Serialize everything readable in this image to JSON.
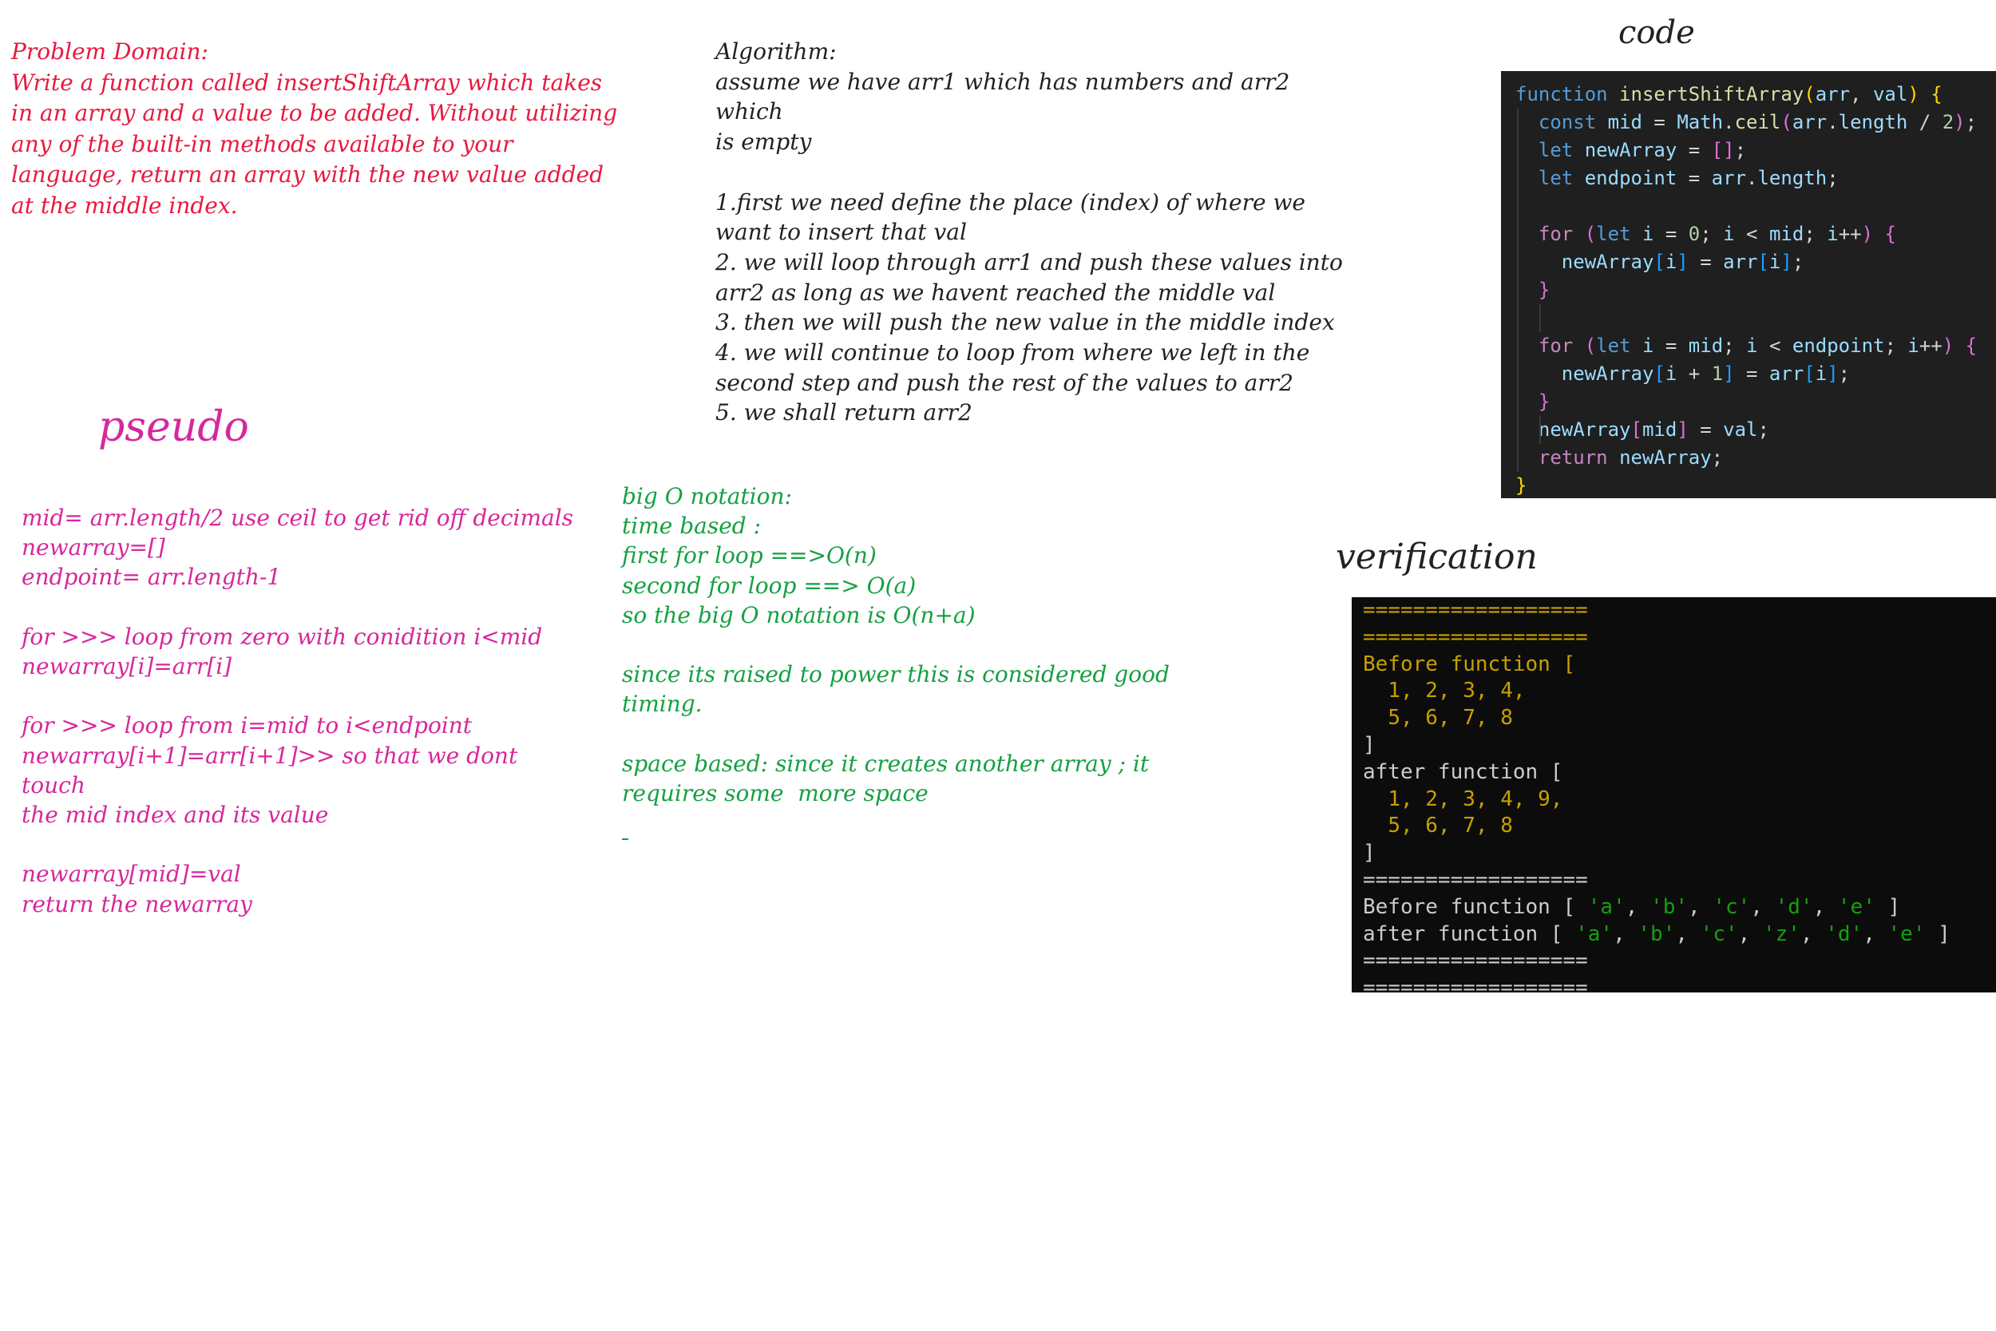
{
  "problem_domain": {
    "text": "Problem Domain:\nWrite a function called insertShiftArray which takes\nin an array and a value to be added. Without utilizing\nany of the built-in methods available to your\nlanguage, return an array with the new value added\nat the middle index."
  },
  "algorithm": {
    "text": "Algorithm:\nassume we have arr1 which has numbers and arr2 which\nis empty\n\n1.first we need define the place (index) of where we\nwant to insert that val\n2. we will loop through arr1 and push these values into\narr2 as long as we havent reached the middle val\n3. then we will push the new value in the middle index\n4. we will continue to loop from where we left in the\nsecond step and push the rest of the values to arr2\n5. we shall return arr2"
  },
  "pseudo": {
    "title": "pseudo",
    "text": "mid= arr.length/2 use ceil to get rid off decimals\nnewarray=[]\nendpoint= arr.length-1\n\nfor >>> loop from zero with conidition i<mid\nnewarray[i]=arr[i]\n\nfor >>> loop from i=mid to i<endpoint\nnewarray[i+1]=arr[i+1]>> so that we dont touch\nthe mid index and its value\n\nnewarray[mid]=val\nreturn the newarray"
  },
  "big_o": {
    "text": "big O notation:\ntime based :\nfirst for loop ==>O(n)\nsecond for loop ==> O(a)\nso the big O notation is O(n+a)\n\nsince its raised to power this is considered good\ntiming.\n\nspace based: since it creates another array ; it\nrequires some  more space"
  },
  "code": {
    "title": "code",
    "lines": [
      "function insertShiftArray(arr, val) {",
      "  const mid = Math.ceil(arr.length / 2);",
      "  let newArray = [];",
      "  let endpoint = arr.length;",
      "",
      "  for (let i = 0; i < mid; i++) {",
      "    newArray[i] = arr[i];",
      "  }",
      "",
      "  for (let i = mid; i < endpoint; i++) {",
      "    newArray[i + 1] = arr[i];",
      "  }",
      "  newArray[mid] = val;",
      "  return newArray;",
      "}"
    ]
  },
  "verification": {
    "title": "verification",
    "separator": "==================",
    "before_label": "Before function [",
    "before_nums_1": "1, 2, 3, 4,",
    "before_nums_2": "5, 6, 7, 8",
    "close_bracket": "]",
    "after_label": "after function [",
    "after_nums_1": "1, 2, 3, 4, 9,",
    "after_nums_2": "5, 6, 7, 8",
    "before_str_label": "Before function [",
    "before_str_items": [
      "'a'",
      "'b'",
      "'c'",
      "'d'",
      "'e'"
    ],
    "after_str_label": "after function [",
    "after_str_items": [
      "'a'",
      "'b'",
      "'c'",
      "'z'",
      "'d'",
      "'e'"
    ]
  },
  "colors": {
    "problem": "#e8193f",
    "pseudo": "#d6289b",
    "big_o": "#16a043",
    "terminal_yellow": "#c7a000",
    "terminal_green": "#13a10e"
  }
}
